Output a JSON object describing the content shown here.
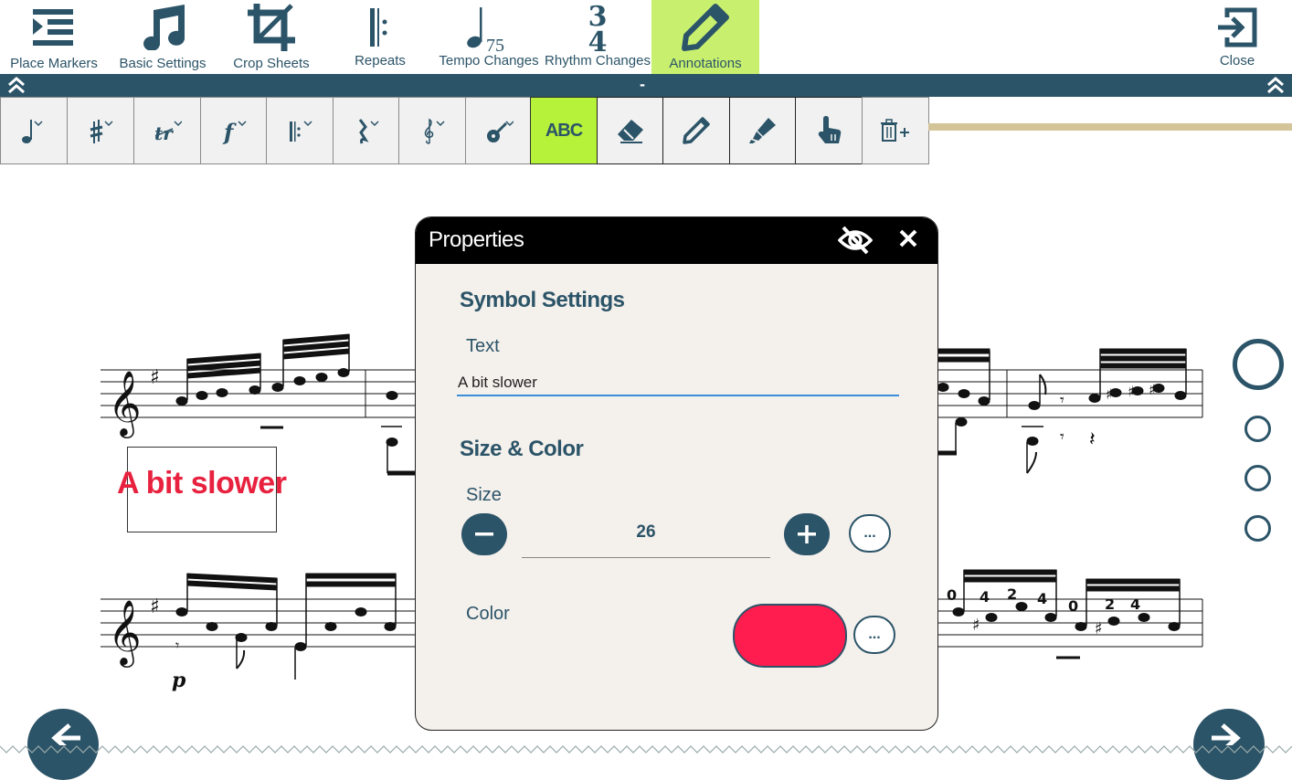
{
  "toolbar": {
    "items": [
      {
        "label": "Place Markers",
        "icon": "list-indent-icon"
      },
      {
        "label": "Basic Settings",
        "icon": "music-note-icon"
      },
      {
        "label": "Crop Sheets",
        "icon": "crop-icon"
      },
      {
        "label": "Repeats",
        "icon": "repeat-sign-icon"
      },
      {
        "label": "Tempo Changes",
        "icon": "tempo-icon",
        "tempo_value": "75"
      },
      {
        "label": "Rhythm Changes",
        "icon": "time-signature-icon",
        "ts_top": "3",
        "ts_bottom": "4"
      },
      {
        "label": "Annotations",
        "icon": "pencil-icon",
        "active": true
      },
      {
        "label": "Close",
        "icon": "exit-icon"
      }
    ],
    "accent_active": "#c8f06e"
  },
  "strip": {
    "center_text": "-"
  },
  "tools": {
    "abc_label": "ABC",
    "items": [
      "note-tool",
      "accidental-tool",
      "ornament-tool",
      "dynamics-tool",
      "repeat-tool",
      "rest-tool",
      "clef-tool",
      "instrument-tool",
      "text-tool",
      "eraser-tool",
      "pencil-tool",
      "highlighter-tool",
      "hand-tool",
      "delete-tool"
    ]
  },
  "score": {
    "annotation_text": "A bit slower",
    "dynamic_mark": "p",
    "fingerings_row2": [
      "0",
      "4",
      "2",
      "4",
      "0",
      "2",
      "4"
    ]
  },
  "dialog": {
    "title": "Properties",
    "symbol_settings": "Symbol Settings",
    "text_label": "Text",
    "text_value": "A bit slower",
    "size_color": "Size & Color",
    "size_label": "Size",
    "size_value": "26",
    "color_label": "Color",
    "color_value": "#ff1c4e",
    "more_label": "..."
  },
  "colors": {
    "primary": "#2c5468",
    "annotation": "#e8213f"
  }
}
